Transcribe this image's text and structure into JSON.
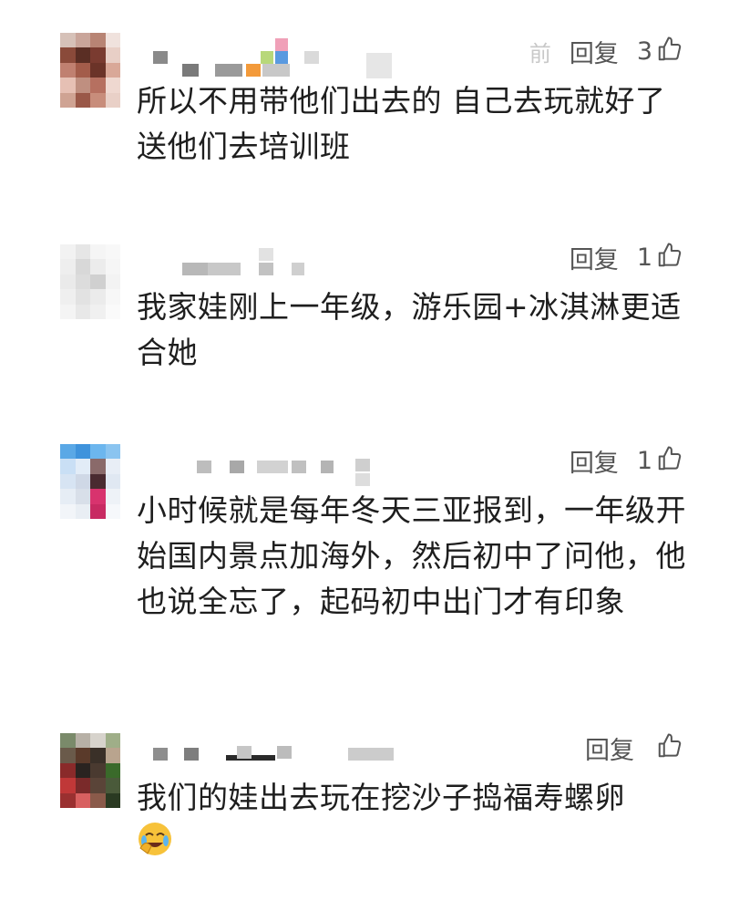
{
  "comments": [
    {
      "time": "前",
      "reply_label": "回复",
      "likes": "3",
      "text": "所以不用带他们出去的 自己去玩就好了 送他们去培训班",
      "avatar_colors": [
        "#d6c1b8",
        "#c9a59a",
        "#b88474",
        "#f0e2dd",
        "#8a4a3a",
        "#5a2e24",
        "#7a3b30",
        "#e8cfc6",
        "#c08070",
        "#a35c4a",
        "#6b3328",
        "#d9a898",
        "#e6c0b4",
        "#bf8f80",
        "#b67060",
        "#efd8d0",
        "#cfa393",
        "#9a5848",
        "#c88d7b",
        "#e9d0c7"
      ]
    },
    {
      "reply_label": "回复",
      "likes": "1",
      "text": "我家娃刚上一年级，游乐园+冰淇淋更适合她",
      "avatar_colors": [
        "#f2f2f2",
        "#e6e6e6",
        "#f5f5f5",
        "#f8f8f8",
        "#eeeeee",
        "#d8d8d8",
        "#ececec",
        "#f6f6f6",
        "#eaeaea",
        "#dcdcdc",
        "#d0d0d0",
        "#f3f3f3",
        "#efefef",
        "#e2e2e2",
        "#ebebeb",
        "#f7f7f7",
        "#f4f4f4",
        "#e8e8e8",
        "#f0f0f0",
        "#fafafa"
      ]
    },
    {
      "reply_label": "回复",
      "likes": "1",
      "text": "小时候就是每年冬天三亚报到，一年级开始国内景点加海外，然后初中了问他，他也说全忘了，起码初中出门才有印象",
      "avatar_colors": [
        "#5aa8e6",
        "#3f93dc",
        "#6cb6ee",
        "#8ac4f0",
        "#c9dff5",
        "#e2ecf7",
        "#8a6a6a",
        "#e8eef6",
        "#d7e4f3",
        "#cfd8e6",
        "#4a2a30",
        "#e0e8f2",
        "#e6edf5",
        "#d8dfe9",
        "#d8336e",
        "#eef2f7",
        "#f2f5f9",
        "#e9eef4",
        "#c82a62",
        "#f6f8fb"
      ]
    },
    {
      "reply_label": "回复",
      "likes": "",
      "text": "我们的娃出去玩在挖沙子捣福寿螺卵",
      "avatar_colors": [
        "#7a8a6a",
        "#b7b0a6",
        "#d7d3cc",
        "#9fae88",
        "#6a5a4a",
        "#5a3a2a",
        "#3a3028",
        "#b9a48e",
        "#8a2a2a",
        "#2a2320",
        "#4a3a30",
        "#3a6a2a",
        "#c03838",
        "#7a2a2a",
        "#5a4438",
        "#4a5a3a",
        "#9a3030",
        "#d86060",
        "#8a5a4a",
        "#2a3a22"
      ]
    }
  ],
  "icons": {
    "like": "thumbs-up-icon",
    "emoji": "cry-laugh-emoji-icon"
  }
}
